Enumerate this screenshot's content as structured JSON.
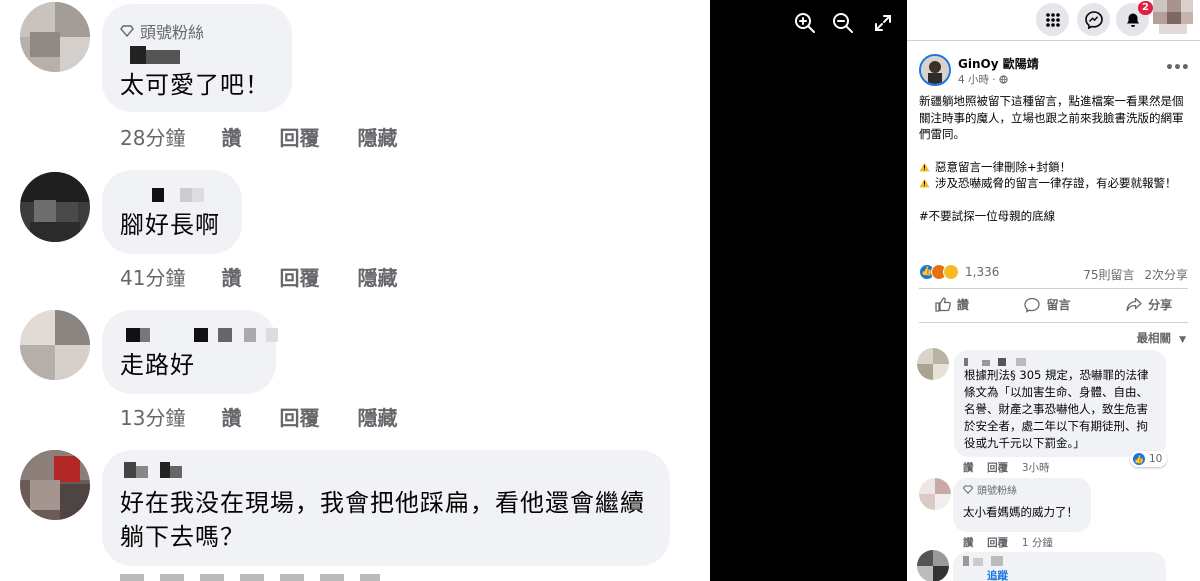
{
  "left_comments": [
    {
      "badge": "頭號粉絲",
      "text": "太可愛了吧！",
      "time": "28分鐘",
      "like": "讚",
      "reply": "回覆",
      "hide": "隱藏"
    },
    {
      "text": "腳好長啊",
      "time": "41分鐘",
      "like": "讚",
      "reply": "回覆",
      "hide": "隱藏"
    },
    {
      "text": "走路好",
      "time": "13分鐘",
      "like": "讚",
      "reply": "回覆",
      "hide": "隱藏"
    },
    {
      "text_line1": "好在我没在現場，我會把他踩扁，看他還會繼續",
      "text_line2": "躺下去嗎？"
    }
  ],
  "viewer": {
    "icons": [
      "zoom-in-icon",
      "zoom-out-icon",
      "fullscreen-icon"
    ]
  },
  "topbar": {
    "notification_count": "2"
  },
  "post": {
    "author": "GinOy 歐陽靖",
    "time": "4 小時 · ",
    "para1": "新疆躺地照被留下這種留言，點進檔案一看果然是個關注時事的魔人，立場也跟之前來我臉書洗版的網軍們雷同。",
    "warn1": "惡意留言一律刪除+封鎖！",
    "warn2": "涉及恐嚇威脅的留言一律存證，有必要就報警！",
    "hashtag": "#不要試探一位母親的底線",
    "reaction_count": "1,336",
    "comments_count": "75則留言",
    "shares_count": "2次分享",
    "like_label": "讚",
    "comment_label": "留言",
    "share_label": "分享",
    "sort_label": "最相關"
  },
  "right_comments": [
    {
      "text": "根據刑法§ 305 規定，恐嚇罪的法律條文為「以加害生命、身體、自由、名譽、財產之事恐嚇他人，致生危害於安全者，處二年以下有期徒刑、拘役或九千元以下罰金。」",
      "like": "讚",
      "reply": "回覆",
      "time": "3小時",
      "likes": "10"
    },
    {
      "badge": "頭號粉絲",
      "text": "太小看媽媽的威力了！",
      "like": "讚",
      "reply": "回覆",
      "time": "1 分鐘"
    },
    {
      "follow": "追蹤"
    }
  ],
  "colors": {
    "accent": "#1b74e4",
    "bubble": "#f0f2f5",
    "muted": "#65676b",
    "viewer_bg": "#000000"
  }
}
